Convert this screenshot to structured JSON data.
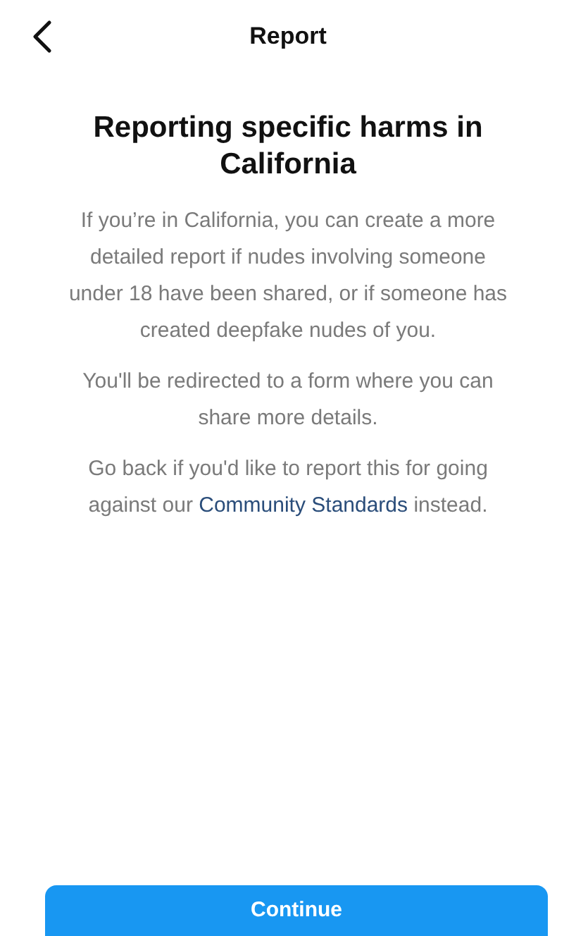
{
  "header": {
    "title": "Report"
  },
  "heading": "Reporting specific harms in California",
  "paragraphs": [
    {
      "text": "If you’re in California, you can create a more detailed report if nudes involving someone under 18 have been shared, or if someone has created deepfake nudes of you."
    },
    {
      "text": "You'll be redirected to a form where you can share more details."
    },
    {
      "text": "Go back if you'd like to report this for going against our ",
      "link": "Community Standards",
      "text_after": " instead."
    }
  ],
  "button": "Continue"
}
